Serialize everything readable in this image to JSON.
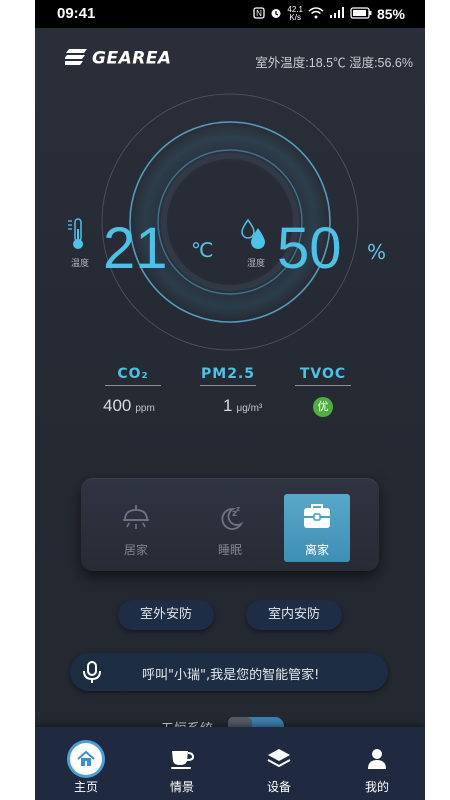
{
  "status_bar": {
    "time": "09:41",
    "net_speed_top": "42.1",
    "net_speed_unit": "K/s",
    "battery": "85%"
  },
  "header": {
    "brand": "GEAREA",
    "outdoor_info": "室外温度:18.5℃  湿度:56.6%"
  },
  "climate": {
    "temperature_label": "温度",
    "temperature_value": "21",
    "temperature_unit": "℃",
    "humidity_label": "湿度",
    "humidity_value": "50",
    "humidity_unit": "%"
  },
  "air_quality": {
    "co2": {
      "label": "CO₂",
      "value": "400",
      "unit": "ppm"
    },
    "pm25": {
      "label": "PM2.5",
      "value": "1",
      "unit": "μg/m³"
    },
    "tvoc": {
      "label": "TVOC",
      "status": "优"
    }
  },
  "modes": {
    "items": [
      {
        "label": "居家",
        "icon": "lamp-icon",
        "active": false
      },
      {
        "label": "睡眠",
        "icon": "moon-sleep-icon",
        "active": false
      },
      {
        "label": "离家",
        "icon": "suitcase-icon",
        "active": true
      }
    ]
  },
  "security": {
    "outdoor_label": "室外安防",
    "indoor_label": "室内安防"
  },
  "voice": {
    "prompt": "呼叫\"小瑞\",我是您的智能管家!"
  },
  "partial_row": {
    "label": "五恒系统"
  },
  "tabbar": {
    "items": [
      {
        "label": "主页",
        "icon": "home-icon"
      },
      {
        "label": "情景",
        "icon": "cup-icon"
      },
      {
        "label": "设备",
        "icon": "layers-icon"
      },
      {
        "label": "我的",
        "icon": "person-icon"
      }
    ],
    "active": 0
  },
  "colors": {
    "accent": "#4fc0e6",
    "active_mode": "#4a9ec4",
    "good_badge": "#4fae3e",
    "tabbar_bg": "#1f2a40"
  }
}
